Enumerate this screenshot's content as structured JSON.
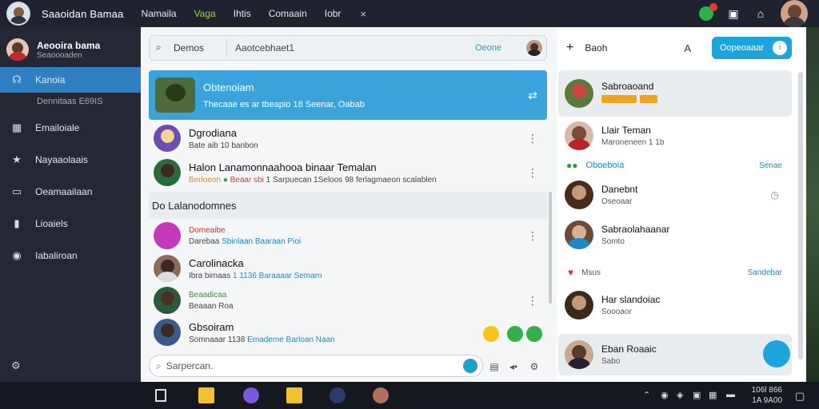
{
  "topbar": {
    "app_title": "Saaoidan Bamaa",
    "tabs": [
      {
        "label": "Namaila",
        "active": false
      },
      {
        "label": "Vaga",
        "active": true
      },
      {
        "label": "Ihtis",
        "active": false
      },
      {
        "label": "Comaain",
        "active": false
      },
      {
        "label": "Iobr",
        "active": false
      }
    ],
    "close_glyph": "×"
  },
  "sidebar": {
    "profile_name": "Aeooira bama",
    "profile_sub": "Seaoooaden",
    "items": [
      {
        "label": "Kanoia",
        "icon": "headset-icon",
        "active": true
      },
      {
        "label": "Dennitaas E69IS",
        "sub": true
      },
      {
        "label": "Emailoiale",
        "icon": "briefcase-icon",
        "active": false
      },
      {
        "label": "Nayaaolaais",
        "icon": "star-icon",
        "active": false
      },
      {
        "label": "Oeamaailaan",
        "icon": "message-icon",
        "active": false
      },
      {
        "label": "Lioaiels",
        "icon": "document-icon",
        "active": false
      },
      {
        "label": "Iabaliroan",
        "icon": "globe-icon",
        "active": false
      }
    ]
  },
  "search": {
    "label": "Demos",
    "value": "Aaotcebhaet1",
    "status": "Oeone"
  },
  "conversations": {
    "highlight": {
      "name": "Obtenoiam",
      "message": "Thecaae es ar tbeapio 18 Seenar, Oabab"
    },
    "row1": {
      "name": "Dgrodiana",
      "message": "Bate aib 10 banbon"
    },
    "row2": {
      "name": "Halon Lanamonnaahooa  binaar Temalan",
      "msg_a": "Berloeon",
      "msg_b": "Beaar sbi",
      "msg_c": "1 Sarpuecan 1Seloos 98 ferlagmaeon scalablen"
    },
    "section_title": "Do Lalanodomnes",
    "row3": {
      "name": "Domeaibe",
      "msg_a": "Darebaa",
      "msg_b": "Sbinlaan Baaraan Pioi"
    },
    "row4": {
      "name": "Carolinacka",
      "msg_a": "Ibra bimaas",
      "msg_b": "1 1136 Baraaaar Semarn"
    },
    "row5": {
      "name": "Beaadicaa",
      "msg_a": "Beaaan Roa"
    },
    "row6": {
      "name": "Gbsoiram",
      "msg_a": "Somnaaar 1138",
      "msg_b": "Emademe Barloan Naan"
    }
  },
  "composer": {
    "placeholder": "Sarpercan."
  },
  "right_panel": {
    "header_title": "Baoh",
    "header_mid": "A",
    "button_label": "Oopeoaaar",
    "rows": [
      {
        "name": "Sabroaoand",
        "sub": "",
        "tag": "",
        "status": ""
      },
      {
        "name": "Llair Teman",
        "sub": "Maroneneen 1 1b",
        "tag": "",
        "status": ""
      },
      {
        "name": "Oboeboia",
        "sub": "",
        "tag": "Senae",
        "status": ""
      },
      {
        "name": "Danebnt",
        "sub": "Oseoaar",
        "tag": "",
        "status": "◷"
      },
      {
        "name": "Sabraolahaanar",
        "sub": "Somto",
        "tag": "",
        "status": ""
      },
      {
        "name": "Msus",
        "sub": "",
        "tag": "Sandebar",
        "status": ""
      },
      {
        "name": "Har slandoiac",
        "sub": "Soooaor",
        "tag": "",
        "status": ""
      },
      {
        "name": "Eban Roaaic",
        "sub": "Sabo",
        "tag": "",
        "status": ""
      }
    ]
  },
  "taskbar": {
    "clock_time": "106l 866",
    "clock_date": "1A 9A00"
  }
}
